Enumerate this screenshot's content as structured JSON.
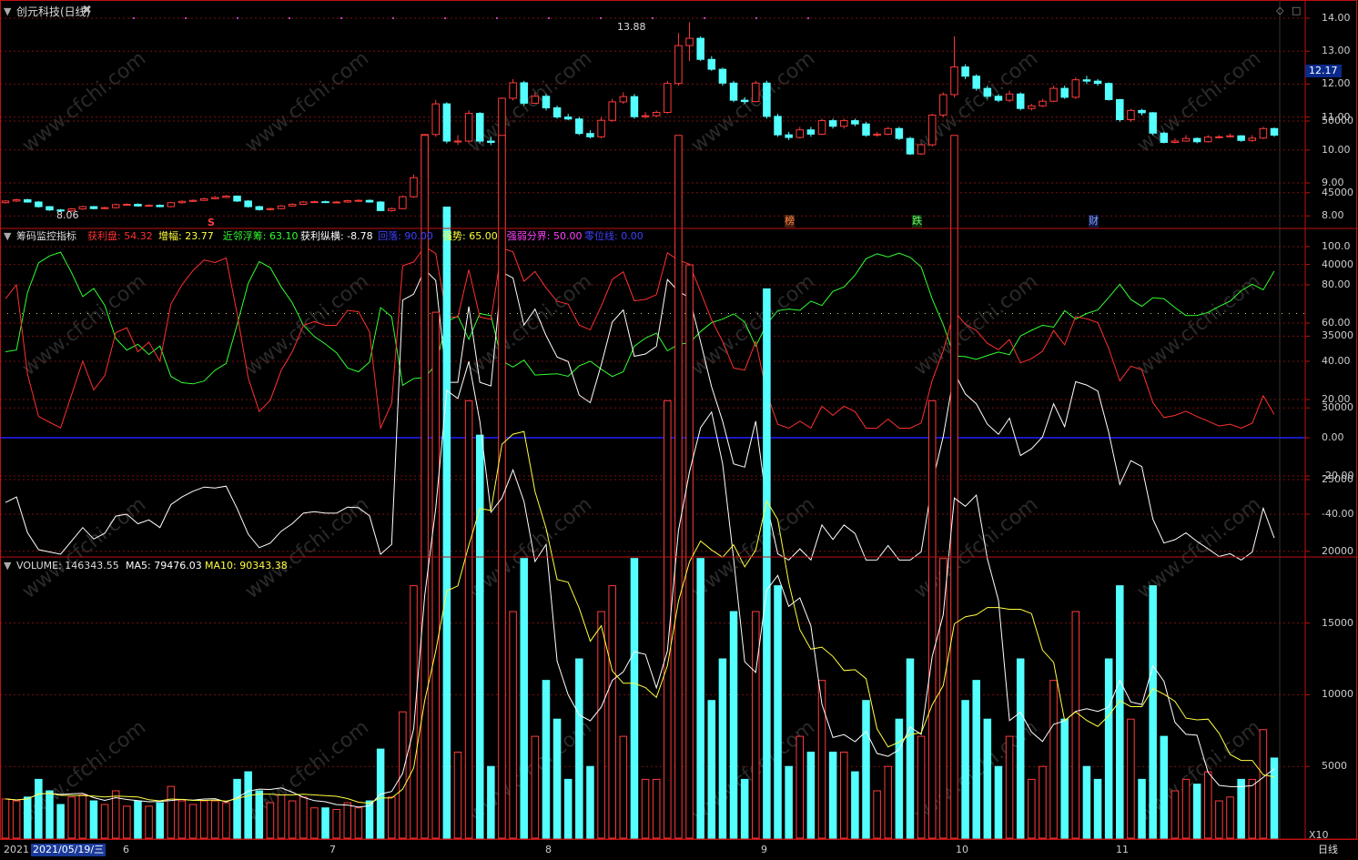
{
  "stock": {
    "title": "创元科技(日线)",
    "high_label": "13.88",
    "low_label": "8.06",
    "last_price": "12.17"
  },
  "colors": {
    "up": "#ff3b3b",
    "down": "#54ffff",
    "grid": "#7a1010",
    "panel_border": "#c01010",
    "zero_line": "#2020ff"
  },
  "price_axis": [
    "14.00",
    "13.00",
    "12.00",
    "11.00",
    "10.00",
    "9.00",
    "8.00"
  ],
  "event_markers": [
    "S",
    "榜",
    "跌",
    "财"
  ],
  "indicator": {
    "name": "筹码监控指标",
    "items": [
      {
        "label": "获利盘: 54.32",
        "color": "#ff3030"
      },
      {
        "label": "增幅: 23.77",
        "color": "#ffff40"
      },
      {
        "label": "近邻浮筹: 63.10",
        "color": "#30ff30"
      },
      {
        "label": "获利纵横: -8.78",
        "color": "#ffffff"
      },
      {
        "label": "回落: 90.00",
        "color": "#4040ff"
      },
      {
        "label": "强势: 65.00",
        "color": "#ffff40"
      },
      {
        "label": "强弱分界: 50.00",
        "color": "#ff40ff"
      },
      {
        "label": "零位线: 0.00",
        "color": "#4040ff"
      }
    ],
    "axis": [
      "100.0",
      "80.00",
      "60.00",
      "40.00",
      "20.00",
      "0.00",
      "-20.00",
      "-40.00"
    ]
  },
  "volume": {
    "name": "VOLUME: 146343.55",
    "ma5": "MA5: 79476.03",
    "ma10": "MA10: 90343.38",
    "axis": [
      "50000",
      "45000",
      "40000",
      "35000",
      "30000",
      "25000",
      "20000",
      "15000",
      "10000",
      "5000"
    ],
    "unit": "X10"
  },
  "time_axis": {
    "year": "2021",
    "cursor_date": "2021/05/19/三",
    "months": [
      "6",
      "7",
      "8",
      "9",
      "10",
      "11"
    ],
    "period_label": "日线"
  },
  "watermark": "www.cfchi.com",
  "chart_data": {
    "type": "candlestick",
    "count": 116,
    "close": [
      8.45,
      8.49,
      8.42,
      8.28,
      8.18,
      8.15,
      8.21,
      8.28,
      8.22,
      8.25,
      8.34,
      8.35,
      8.3,
      8.32,
      8.28,
      8.4,
      8.44,
      8.47,
      8.52,
      8.56,
      8.6,
      8.45,
      8.28,
      8.19,
      8.22,
      8.3,
      8.35,
      8.42,
      8.43,
      8.42,
      8.42,
      8.46,
      8.47,
      8.42,
      8.16,
      8.22,
      8.58,
      9.16,
      10.47,
      11.4,
      10.27,
      10.27,
      11.11,
      10.27,
      10.23,
      11.57,
      12.04,
      11.42,
      11.63,
      11.28,
      11.0,
      10.94,
      10.5,
      10.4,
      10.9,
      11.46,
      11.62,
      11.01,
      11.04,
      11.14,
      12.02,
      13.17,
      13.39,
      12.75,
      12.45,
      12.03,
      11.51,
      11.47,
      12.03,
      11.02,
      10.46,
      10.38,
      10.61,
      10.48,
      10.89,
      10.72,
      10.89,
      10.79,
      10.45,
      10.48,
      10.65,
      10.35,
      9.88,
      10.16,
      11.06,
      11.68,
      12.52,
      12.24,
      11.87,
      11.63,
      11.51,
      11.7,
      11.26,
      11.34,
      11.48,
      11.87,
      11.6,
      12.13,
      12.09,
      12.02,
      11.53,
      10.92,
      11.2,
      11.13,
      10.51,
      10.23,
      10.27,
      10.35,
      10.25,
      10.39,
      10.4,
      10.43,
      10.29,
      10.36,
      10.65,
      10.45
    ],
    "open": [
      8.4,
      8.45,
      8.49,
      8.42,
      8.28,
      8.18,
      8.15,
      8.21,
      8.28,
      8.22,
      8.25,
      8.34,
      8.35,
      8.3,
      8.32,
      8.28,
      8.4,
      8.44,
      8.47,
      8.52,
      8.56,
      8.6,
      8.45,
      8.28,
      8.19,
      8.22,
      8.3,
      8.35,
      8.42,
      8.43,
      8.42,
      8.42,
      8.46,
      8.47,
      8.42,
      8.16,
      8.22,
      8.58,
      9.16,
      10.47,
      11.4,
      10.27,
      10.27,
      11.11,
      10.27,
      10.23,
      11.57,
      12.04,
      11.42,
      11.63,
      11.28,
      11.0,
      10.94,
      10.5,
      10.4,
      10.9,
      11.46,
      11.62,
      11.01,
      11.04,
      11.14,
      12.02,
      13.17,
      13.39,
      12.75,
      12.45,
      12.03,
      11.51,
      11.47,
      12.03,
      11.02,
      10.46,
      10.38,
      10.61,
      10.48,
      10.89,
      10.72,
      10.89,
      10.79,
      10.45,
      10.48,
      10.65,
      10.35,
      9.88,
      10.16,
      11.06,
      11.68,
      12.52,
      12.24,
      11.87,
      11.63,
      11.51,
      11.7,
      11.26,
      11.34,
      11.48,
      11.87,
      11.6,
      12.13,
      12.09,
      12.02,
      11.53,
      10.92,
      11.2,
      11.13,
      10.51,
      10.23,
      10.27,
      10.35,
      10.25,
      10.39,
      10.4,
      10.43,
      10.29,
      10.36,
      10.65
    ],
    "high": [
      8.48,
      8.52,
      8.52,
      8.45,
      8.3,
      8.21,
      8.24,
      8.31,
      8.3,
      8.28,
      8.37,
      8.38,
      8.38,
      8.35,
      8.35,
      8.43,
      8.47,
      8.5,
      8.55,
      8.6,
      8.63,
      8.62,
      8.48,
      8.31,
      8.25,
      8.33,
      8.38,
      8.45,
      8.46,
      8.46,
      8.45,
      8.49,
      8.5,
      8.5,
      8.45,
      8.25,
      8.62,
      9.25,
      10.47,
      11.52,
      11.45,
      10.45,
      11.2,
      11.15,
      10.4,
      11.6,
      12.15,
      12.1,
      11.75,
      11.7,
      11.35,
      11.1,
      11.0,
      10.6,
      11.0,
      11.55,
      11.75,
      11.7,
      11.15,
      11.2,
      12.1,
      13.55,
      13.88,
      13.45,
      12.85,
      12.5,
      12.1,
      11.6,
      12.1,
      12.1,
      11.1,
      10.55,
      10.7,
      10.7,
      10.95,
      10.95,
      10.95,
      10.95,
      10.85,
      10.55,
      10.7,
      10.7,
      10.4,
      10.2,
      11.1,
      11.75,
      13.45,
      12.6,
      12.3,
      11.95,
      11.7,
      11.8,
      11.75,
      11.4,
      11.55,
      11.95,
      11.95,
      12.2,
      12.25,
      12.15,
      12.05,
      11.55,
      11.25,
      11.25,
      11.15,
      10.55,
      10.35,
      10.45,
      10.38,
      10.45,
      10.45,
      10.5,
      10.45,
      10.45,
      10.7,
      10.68
    ],
    "low": [
      8.37,
      8.42,
      8.4,
      8.25,
      8.15,
      8.13,
      8.12,
      8.18,
      8.2,
      8.2,
      8.22,
      8.31,
      8.28,
      8.28,
      8.26,
      8.26,
      8.37,
      8.42,
      8.45,
      8.5,
      8.54,
      8.42,
      8.25,
      8.16,
      8.16,
      8.2,
      8.28,
      8.33,
      8.4,
      8.4,
      8.4,
      8.4,
      8.44,
      8.4,
      8.14,
      8.13,
      8.2,
      8.55,
      9.1,
      10.4,
      10.2,
      10.15,
      10.2,
      10.2,
      10.15,
      10.2,
      11.5,
      11.35,
      11.4,
      11.2,
      10.95,
      10.9,
      10.45,
      10.35,
      10.35,
      10.85,
      11.4,
      10.95,
      10.95,
      11.0,
      11.1,
      11.95,
      12.7,
      12.7,
      12.4,
      11.95,
      11.45,
      11.4,
      11.45,
      10.95,
      10.4,
      10.3,
      10.35,
      10.4,
      10.45,
      10.65,
      10.65,
      10.72,
      10.4,
      10.4,
      10.45,
      10.3,
      9.85,
      9.85,
      10.1,
      11.0,
      11.6,
      12.15,
      11.8,
      11.55,
      11.45,
      11.45,
      11.2,
      11.2,
      11.3,
      11.45,
      11.55,
      11.55,
      12.0,
      11.95,
      11.5,
      10.85,
      10.85,
      11.05,
      10.45,
      10.2,
      10.2,
      10.25,
      10.2,
      10.22,
      10.35,
      10.38,
      10.25,
      10.25,
      10.33,
      10.4
    ],
    "volume_ma10_last": 90343.38
  }
}
